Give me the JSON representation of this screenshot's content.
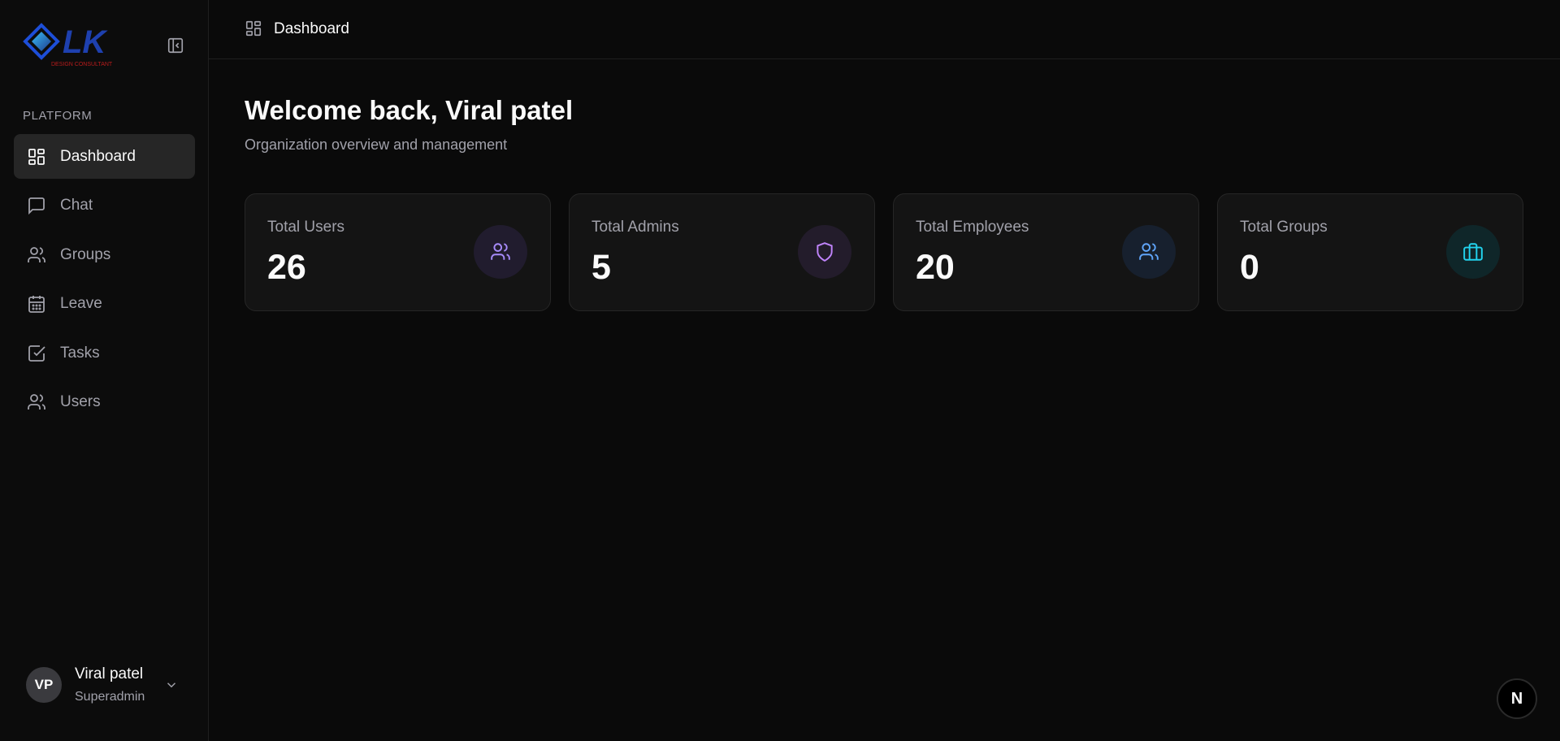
{
  "sidebar": {
    "logo_text": "LK",
    "logo_tagline": "DESIGN CONSULTANT",
    "section_label": "PLATFORM",
    "items": [
      {
        "label": "Dashboard",
        "icon": "dashboard-icon",
        "active": true
      },
      {
        "label": "Chat",
        "icon": "chat-icon"
      },
      {
        "label": "Groups",
        "icon": "users-icon"
      },
      {
        "label": "Leave",
        "icon": "calendar-icon"
      },
      {
        "label": "Tasks",
        "icon": "checkbox-icon"
      },
      {
        "label": "Users",
        "icon": "users-icon"
      }
    ],
    "user": {
      "initials": "VP",
      "name": "Viral patel",
      "role": "Superadmin"
    }
  },
  "header": {
    "breadcrumb": "Dashboard"
  },
  "main": {
    "welcome": "Welcome back, Viral patel",
    "subtitle": "Organization overview and management",
    "cards": [
      {
        "label": "Total Users",
        "value": "26",
        "icon": "users-icon",
        "color": "#a78bfa",
        "badge_bg": "#211c2e"
      },
      {
        "label": "Total Admins",
        "value": "5",
        "icon": "shield-icon",
        "color": "#c084fc",
        "badge_bg": "#231c2b"
      },
      {
        "label": "Total Employees",
        "value": "20",
        "icon": "users-icon",
        "color": "#60a5fa",
        "badge_bg": "#17202e"
      },
      {
        "label": "Total Groups",
        "value": "0",
        "icon": "briefcase-icon",
        "color": "#22d3ee",
        "badge_bg": "#0f2629"
      }
    ]
  },
  "floating": {
    "next_badge": "N"
  }
}
